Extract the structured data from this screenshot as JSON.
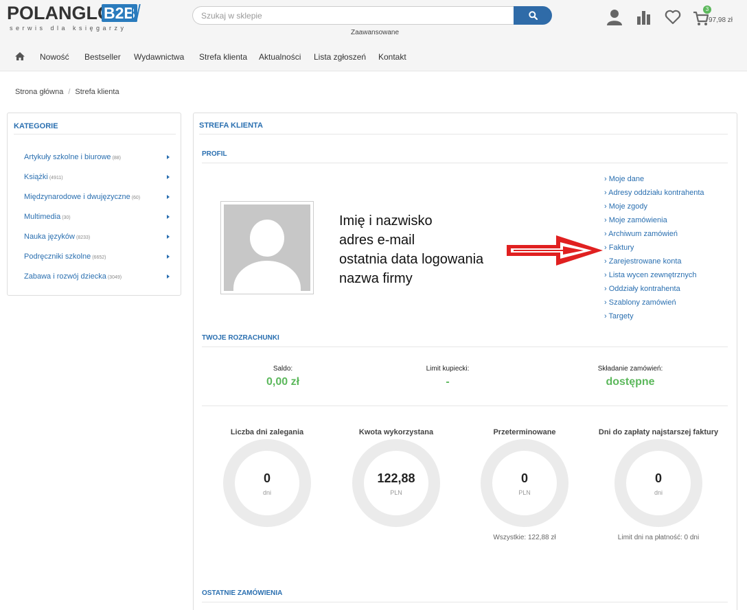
{
  "header": {
    "logo_main": "POLANGLO",
    "logo_b2b": "B2B",
    "logo_tagline": "serwis dla księgarzy",
    "search_placeholder": "Szukaj w sklepie",
    "advanced_search": "Zaawansowane",
    "cart_count": "3",
    "cart_total": "97,98 zł",
    "icons": [
      "user-icon",
      "stats-icon",
      "heart-icon",
      "cart-icon",
      "search-icon"
    ]
  },
  "nav": {
    "items": [
      "Nowość",
      "Bestseller",
      "Wydawnictwa",
      "Strefa klienta",
      "Aktualności",
      "Lista zgłoszeń",
      "Kontakt"
    ]
  },
  "breadcrumb": {
    "home": "Strona główna",
    "separator": "/",
    "current": "Strefa klienta"
  },
  "sidebar": {
    "title": "KATEGORIE",
    "categories": [
      {
        "label": "Artykuły szkolne i biurowe",
        "count": "(88)"
      },
      {
        "label": "Książki",
        "count": "(4911)"
      },
      {
        "label": "Międzynarodowe i dwujęzyczne",
        "count": "(60)"
      },
      {
        "label": "Multimedia",
        "count": "(30)"
      },
      {
        "label": "Nauka języków",
        "count": "(8233)"
      },
      {
        "label": "Podręczniki szkolne",
        "count": "(6652)"
      },
      {
        "label": "Zabawa i rozwój dziecka",
        "count": "(3049)"
      }
    ]
  },
  "main": {
    "title": "STREFA KLIENTA",
    "profile": {
      "title": "PROFIL",
      "info": [
        "Imię i nazwisko",
        "adres e-mail",
        "ostatnia data logowania",
        "nazwa firmy"
      ],
      "links": [
        "Moje dane",
        "Adresy oddziału kontrahenta",
        "Moje zgody",
        "Moje zamówienia",
        "Archiwum zamówień",
        "Faktury",
        "Zarejestrowane konta",
        "Lista wycen zewnętrznych",
        "Oddziały kontrahenta",
        "Szablony zamówień",
        "Targety"
      ]
    },
    "accounts": {
      "title": "TWOJE ROZRACHUNKI",
      "stats": [
        {
          "label": "Saldo:",
          "value": "0,00 zł"
        },
        {
          "label": "Limit kupiecki:",
          "value": "-"
        },
        {
          "label": "Składanie zamówień:",
          "value": "dostępne"
        }
      ],
      "gauges": [
        {
          "title": "Liczba dni zalegania",
          "value": "0",
          "unit": "dni",
          "note": ""
        },
        {
          "title": "Kwota wykorzystana",
          "value": "122,88",
          "unit": "PLN",
          "note": ""
        },
        {
          "title": "Przeterminowane",
          "value": "0",
          "unit": "PLN",
          "note": "Wszystkie: 122,88 zł"
        },
        {
          "title": "Dni do zapłaty najstarszej faktury",
          "value": "0",
          "unit": "dni",
          "note": "Limit dni na płatność: 0 dni"
        }
      ]
    },
    "recent_orders_title": "OSTATNIE ZAMÓWIENIA"
  },
  "colors": {
    "accent": "#2a6fb0",
    "success": "#5cb85c",
    "arrow": "#e02020"
  }
}
